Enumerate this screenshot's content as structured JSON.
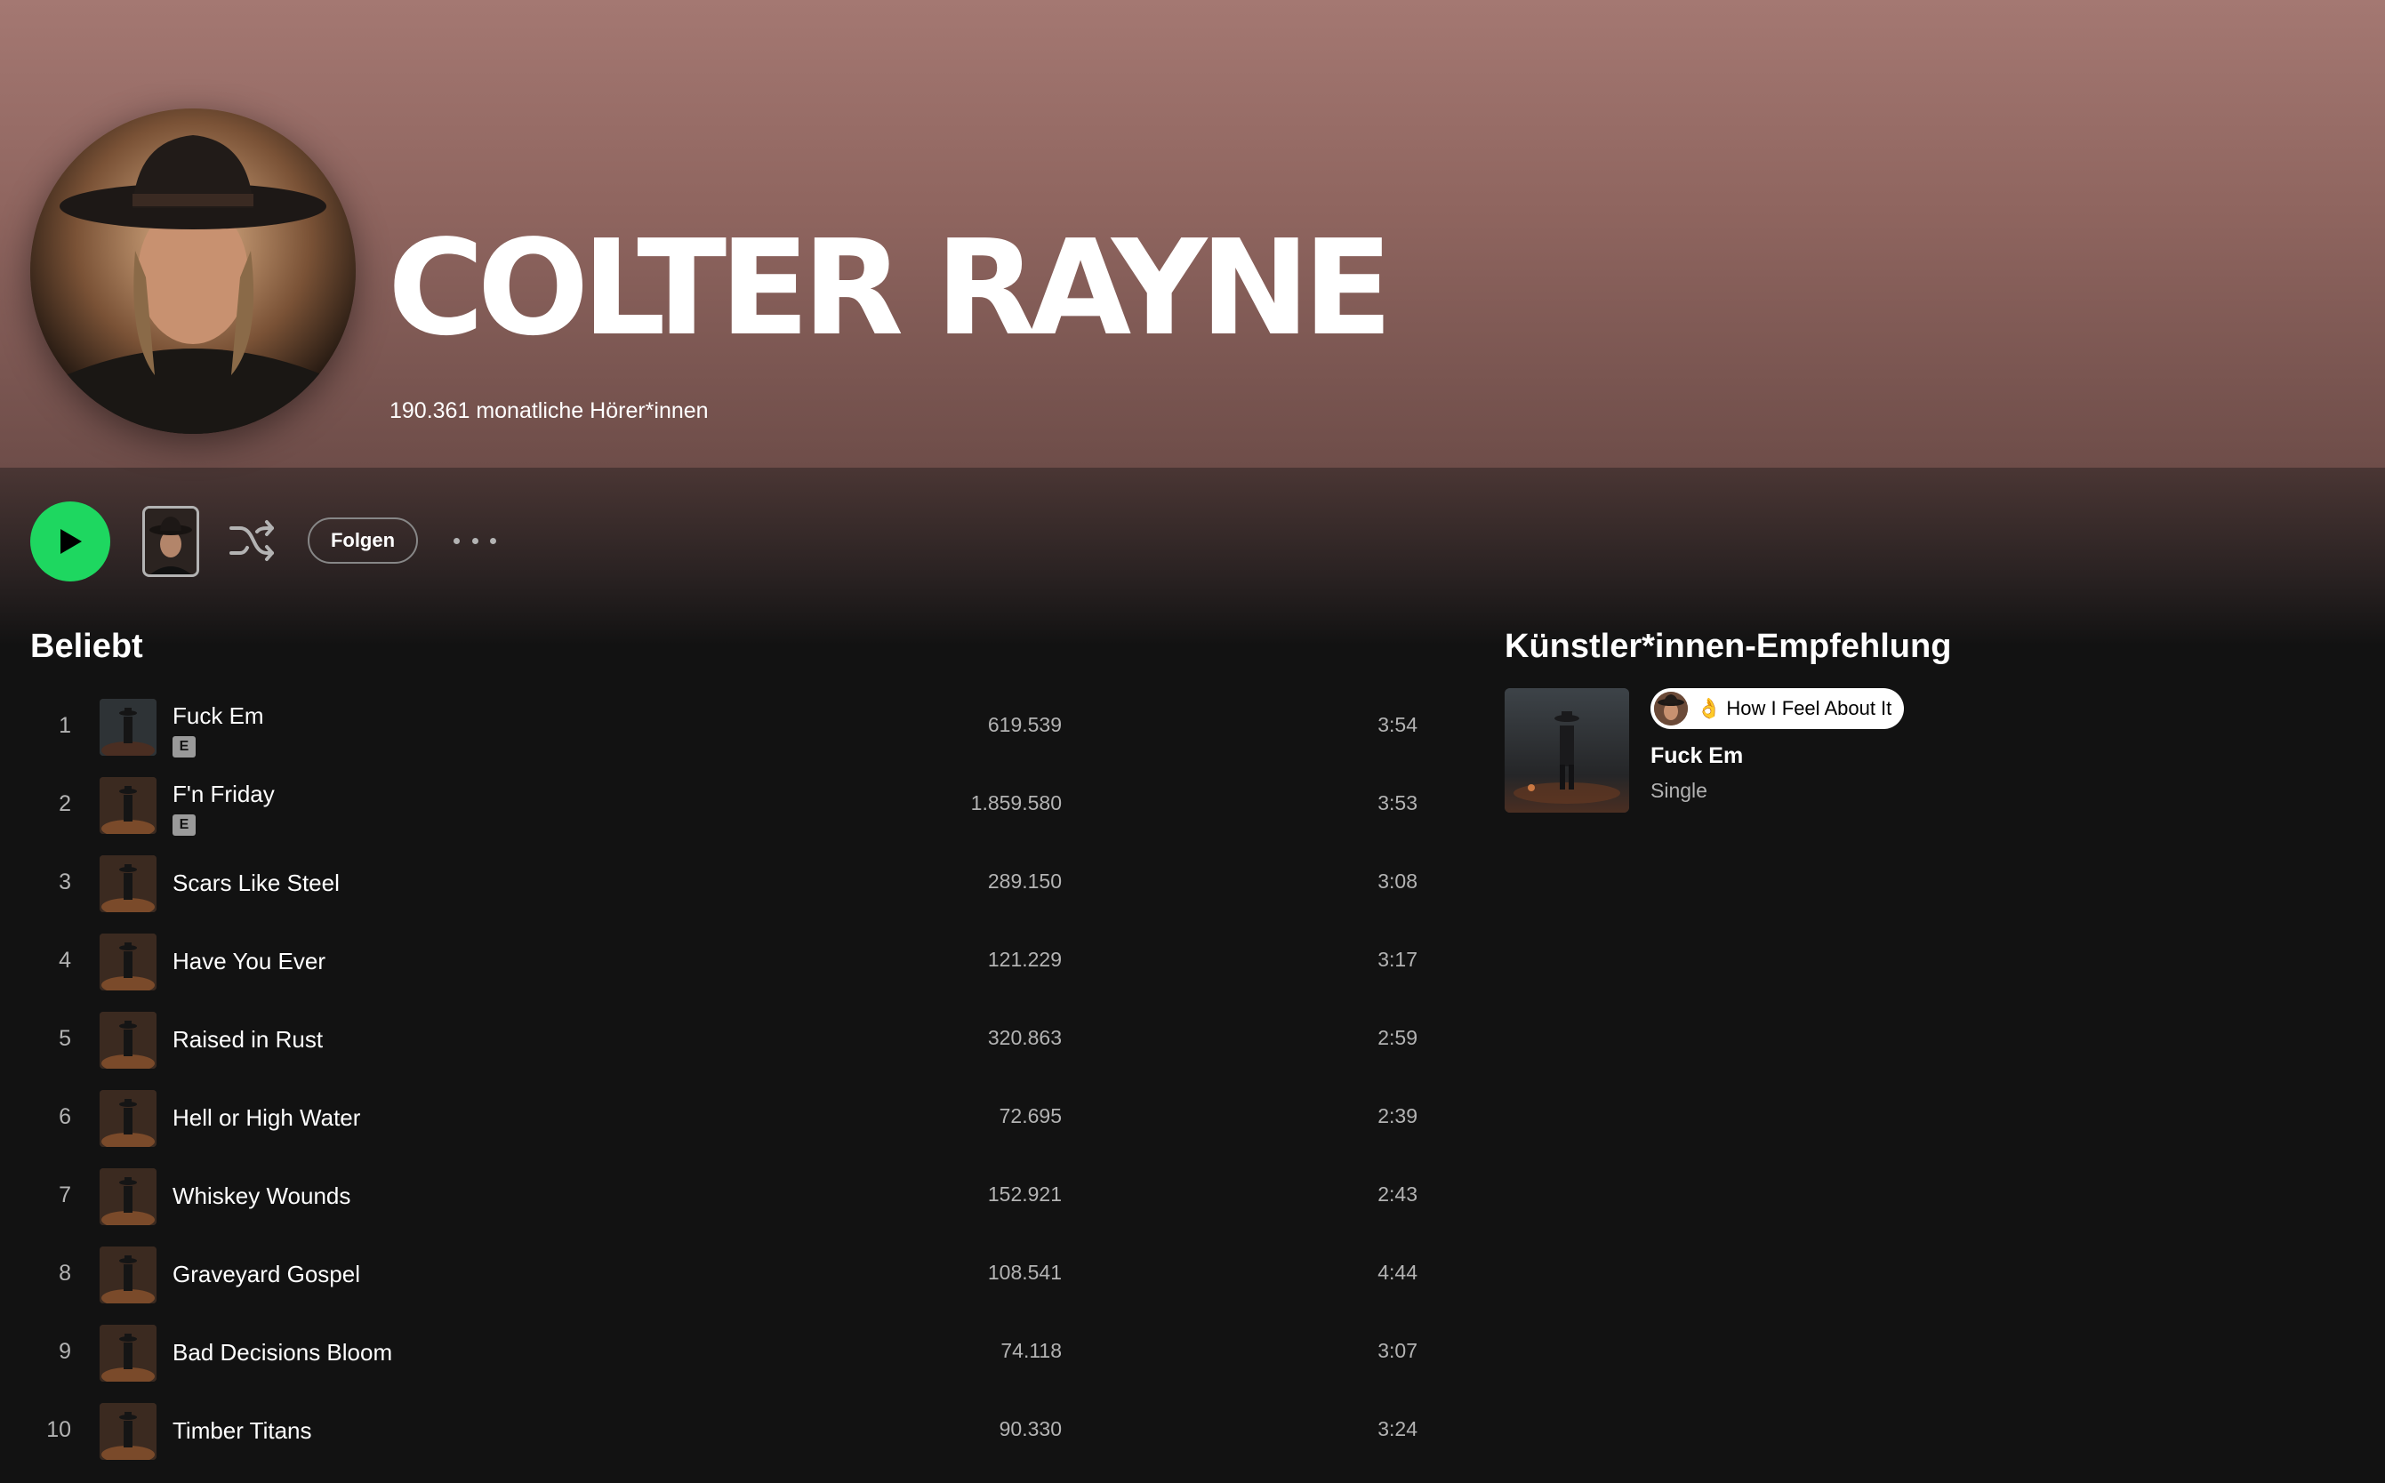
{
  "artist": {
    "name": "COLTER RAYNE",
    "monthly_listeners": "190.361 monatliche Hörer*innen"
  },
  "controls": {
    "play_icon": "play-icon",
    "shuffle_icon": "shuffle-icon",
    "follow_label": "Folgen",
    "more_icon": "more-options-icon"
  },
  "popular": {
    "title": "Beliebt",
    "explicit_badge": "E",
    "tracks": [
      {
        "num": "1",
        "title": "Fuck Em",
        "explicit": true,
        "plays": "619.539",
        "duration": "3:54"
      },
      {
        "num": "2",
        "title": "F'n Friday",
        "explicit": true,
        "plays": "1.859.580",
        "duration": "3:53"
      },
      {
        "num": "3",
        "title": "Scars Like Steel",
        "explicit": false,
        "plays": "289.150",
        "duration": "3:08"
      },
      {
        "num": "4",
        "title": "Have You Ever",
        "explicit": false,
        "plays": "121.229",
        "duration": "3:17"
      },
      {
        "num": "5",
        "title": "Raised in Rust",
        "explicit": false,
        "plays": "320.863",
        "duration": "2:59"
      },
      {
        "num": "6",
        "title": "Hell or High Water",
        "explicit": false,
        "plays": "72.695",
        "duration": "2:39"
      },
      {
        "num": "7",
        "title": "Whiskey Wounds",
        "explicit": false,
        "plays": "152.921",
        "duration": "2:43"
      },
      {
        "num": "8",
        "title": "Graveyard Gospel",
        "explicit": false,
        "plays": "108.541",
        "duration": "4:44"
      },
      {
        "num": "9",
        "title": "Bad Decisions Bloom",
        "explicit": false,
        "plays": "74.118",
        "duration": "3:07"
      },
      {
        "num": "10",
        "title": "Timber Titans",
        "explicit": false,
        "plays": "90.330",
        "duration": "3:24"
      }
    ]
  },
  "recommendation": {
    "title": "Künstler*innen-Empfehlung",
    "pill_emoji": "👌",
    "pill_text": "How I Feel About It",
    "release_title": "Fuck Em",
    "release_type": "Single"
  },
  "colors": {
    "accent_green": "#1ed760",
    "hero_top": "#a47872",
    "background": "#121212"
  }
}
